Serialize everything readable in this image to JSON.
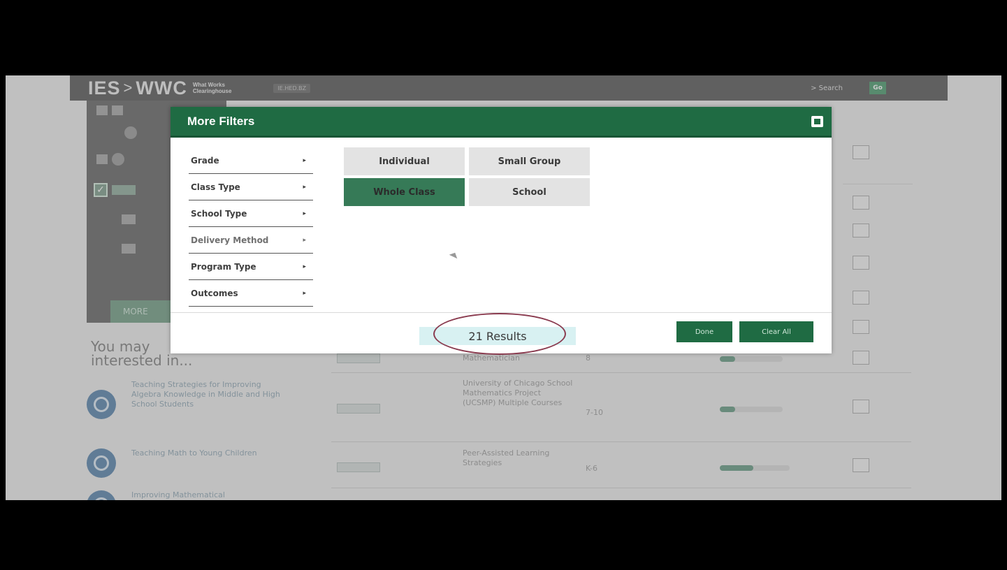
{
  "header": {
    "logo_ies": "IES",
    "logo_sep": ">",
    "logo_wwc": "WWC",
    "logo_sub_1": "What Works",
    "logo_sub_2": "Clearinghouse",
    "crumb": "IE.HED.BZ",
    "search_label": "> Search",
    "go_label": "Go"
  },
  "left_panel": {
    "more_button": "MORE"
  },
  "background": {
    "you_may_1": "You may",
    "you_may_2": "interested in...",
    "items": [
      {
        "title": "Teaching Strategies for Improving Algebra Knowledge in Middle and High School Students",
        "program": "University of Chicago School Mathematics Project (UCSMP) Multiple Courses",
        "grade": "7-10"
      },
      {
        "title": "Teaching Math to Young Children",
        "program": "Peer-Assisted Learning Strategies",
        "grade": "K-6"
      },
      {
        "title": "Improving Mathematical",
        "program": "",
        "grade": ""
      }
    ],
    "top_row_program": "Mathematician",
    "top_row_grade": "8"
  },
  "modal": {
    "title": "More Filters",
    "categories": [
      {
        "label": "Grade",
        "arrow": "▸"
      },
      {
        "label": "Class Type",
        "arrow": "▸"
      },
      {
        "label": "School Type",
        "arrow": "▸"
      },
      {
        "label": "Delivery Method",
        "arrow": "▸"
      },
      {
        "label": "Program Type",
        "arrow": "▸"
      },
      {
        "label": "Outcomes",
        "arrow": "▸"
      }
    ],
    "options": [
      {
        "label": "Individual",
        "selected": false
      },
      {
        "label": "Small Group",
        "selected": false
      },
      {
        "label": "Whole Class",
        "selected": true
      },
      {
        "label": "School",
        "selected": false
      }
    ],
    "results_text": "21 Results",
    "done_label": "Done",
    "clear_label": "Clear All"
  },
  "colors": {
    "brand_green": "#1f6b43",
    "selected_green": "#367a57",
    "header_dark": "#3d3d3d"
  }
}
